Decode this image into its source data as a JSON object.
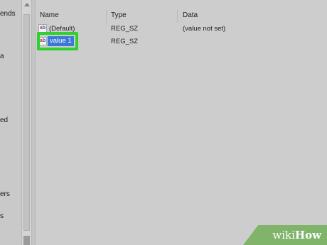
{
  "tree": {
    "labels": [
      "ends",
      "a",
      "ed",
      "ers",
      "s"
    ]
  },
  "list": {
    "columns": [
      "Name",
      "Type",
      "Data"
    ],
    "rows": [
      {
        "name": "(Default)",
        "type": "REG_SZ",
        "data": "(value not set)",
        "icon": "ab-string-icon"
      },
      {
        "name": "value 1",
        "type": "REG_SZ",
        "data": "",
        "icon": "ab-string-icon"
      }
    ]
  },
  "watermark": {
    "prefix": "wiki",
    "suffix": "How"
  },
  "colors": {
    "selection": "#3b78d8",
    "highlight": "#2fd12f",
    "watermark": "#7fb46a"
  }
}
